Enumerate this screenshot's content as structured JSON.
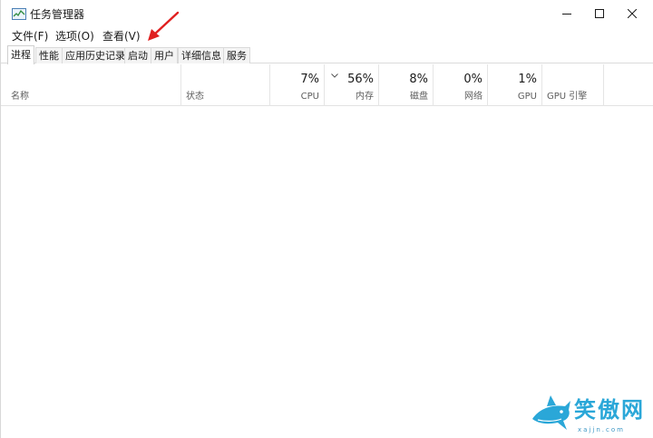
{
  "window": {
    "title": "任务管理器",
    "icon": "task-manager-icon"
  },
  "menu": [
    {
      "label": "文件(F)"
    },
    {
      "label": "选项(O)"
    },
    {
      "label": "查看(V)"
    }
  ],
  "tabs": [
    {
      "label": "进程",
      "active": true
    },
    {
      "label": "性能"
    },
    {
      "label": "应用历史记录"
    },
    {
      "label": "启动"
    },
    {
      "label": "用户"
    },
    {
      "label": "详细信息"
    },
    {
      "label": "服务"
    }
  ],
  "columns": {
    "name": {
      "label": "名称"
    },
    "status": {
      "label": "状态"
    },
    "cpu": {
      "label": "CPU",
      "percent": "7%"
    },
    "memory": {
      "label": "内存",
      "percent": "56%"
    },
    "disk": {
      "label": "磁盘",
      "percent": "8%"
    },
    "network": {
      "label": "网络",
      "percent": "0%"
    },
    "gpu": {
      "label": "GPU",
      "percent": "1%"
    },
    "gpu_engine": {
      "label": "GPU 引擎"
    }
  },
  "watermark": {
    "text": "笑傲网",
    "sub": "xajjn.com"
  },
  "colors": {
    "annotation_arrow": "#e02020",
    "watermark": "#2aa7d8"
  }
}
